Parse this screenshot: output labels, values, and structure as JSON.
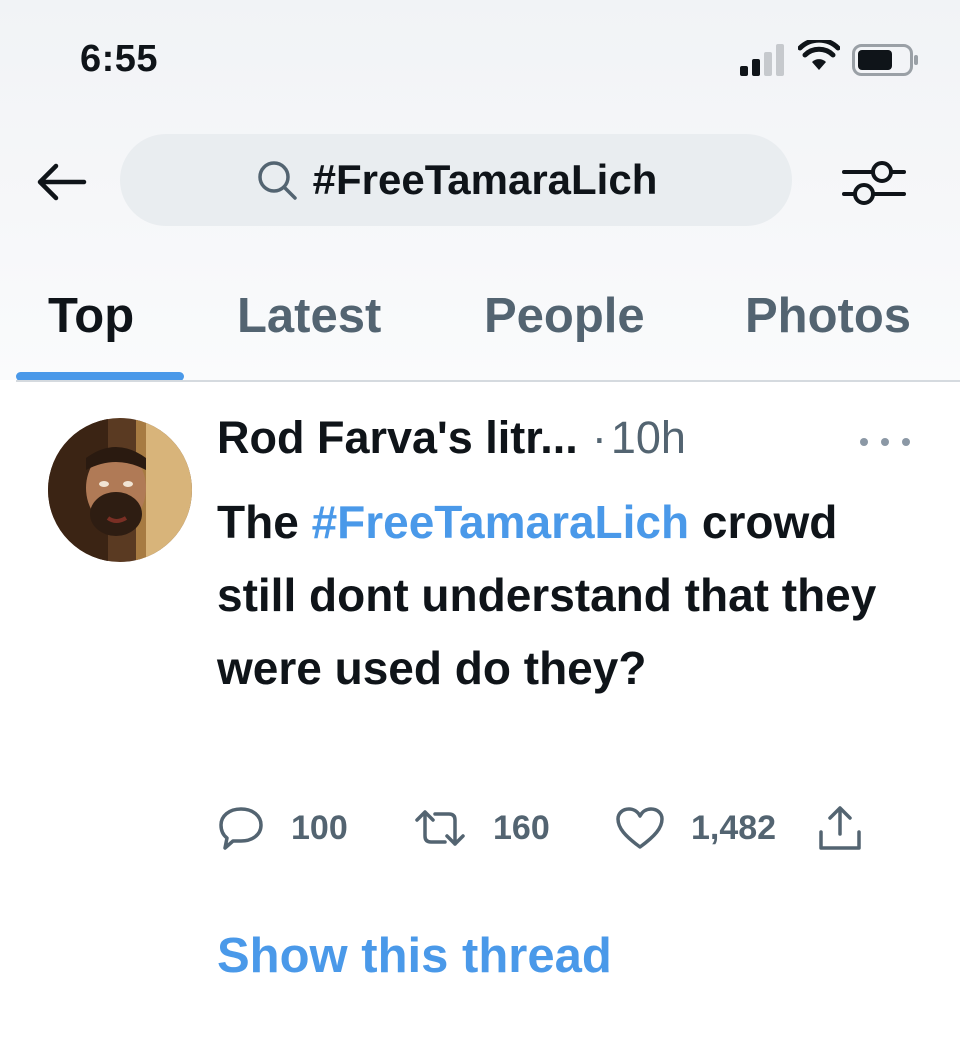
{
  "status_bar": {
    "time": "6:55",
    "icons": [
      "cellular-signal-icon",
      "wifi-icon",
      "battery-icon"
    ]
  },
  "search": {
    "query": "#FreeTamaraLich"
  },
  "tabs": [
    {
      "label": "Top",
      "active": true
    },
    {
      "label": "Latest",
      "active": false
    },
    {
      "label": "People",
      "active": false
    },
    {
      "label": "Photos",
      "active": false
    }
  ],
  "tweet": {
    "author": "Rod Farva's litr...",
    "separator": "·",
    "time": "10h",
    "text_prefix": "The ",
    "hashtag": "#FreeTamaraLich",
    "text_rest": "crowd still dont understand that they were used do they?",
    "replies": "100",
    "retweets": "160",
    "likes": "1,482",
    "show_thread": "Show this thread"
  },
  "colors": {
    "accent": "#4a99e9",
    "text": "#0f1419",
    "secondary": "#536471",
    "search_bg": "#e9edf0"
  }
}
